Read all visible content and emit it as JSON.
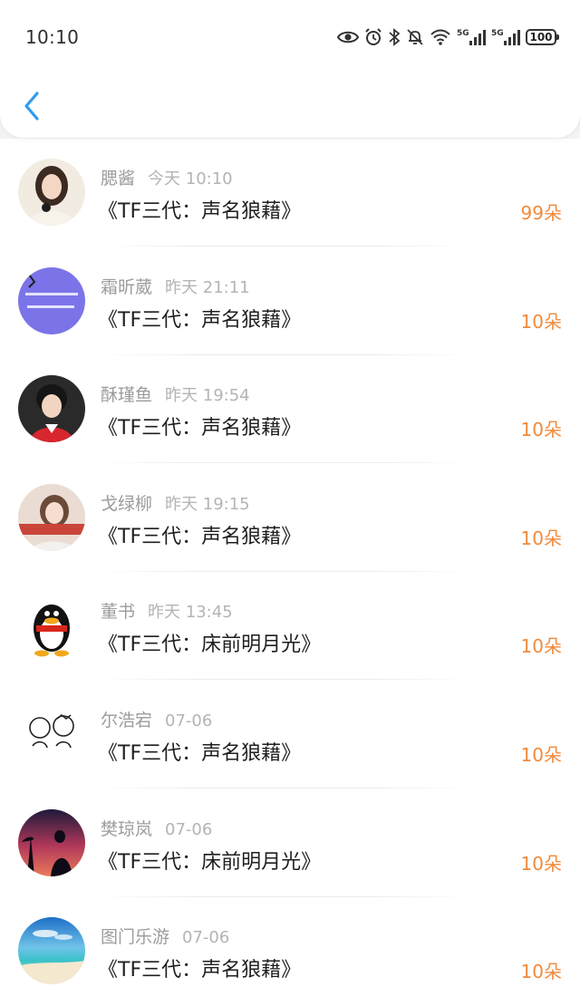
{
  "status_bar": {
    "time": "10:10",
    "battery": "100",
    "net1": "5G",
    "net2": "5G"
  },
  "accent_color": "#2f9df0",
  "count_color": "#f08a3c",
  "items": [
    {
      "name": "腮酱",
      "time": "今天 10:10",
      "title": "《TF三代：声名狼藉》",
      "count": "99朵",
      "avatar": "girl-portrait-icon"
    },
    {
      "name": "霜昕葳",
      "time": "昨天 21:11",
      "title": "《TF三代：声名狼藉》",
      "count": "10朵",
      "avatar": "purple-text-avatar-icon"
    },
    {
      "name": "酥瑾鱼",
      "time": "昨天 19:54",
      "title": "《TF三代：声名狼藉》",
      "count": "10朵",
      "avatar": "boy-portrait-icon"
    },
    {
      "name": "戈绿柳",
      "time": "昨天 19:15",
      "title": "《TF三代：声名狼藉》",
      "count": "10朵",
      "avatar": "girl-banner-avatar-icon"
    },
    {
      "name": "董书",
      "time": "昨天 13:45",
      "title": "《TF三代：床前明月光》",
      "count": "10朵",
      "avatar": "penguin-avatar-icon"
    },
    {
      "name": "尔浩宕",
      "time": "07-06",
      "title": "《TF三代：声名狼藉》",
      "count": "10朵",
      "avatar": "cartoon-couple-avatar-icon"
    },
    {
      "name": "樊琼岚",
      "time": "07-06",
      "title": "《TF三代：床前明月光》",
      "count": "10朵",
      "avatar": "sunset-silhouette-avatar-icon"
    },
    {
      "name": "图门乐游",
      "time": "07-06",
      "title": "《TF三代：声名狼藉》",
      "count": "10朵",
      "avatar": "beach-avatar-icon"
    }
  ]
}
